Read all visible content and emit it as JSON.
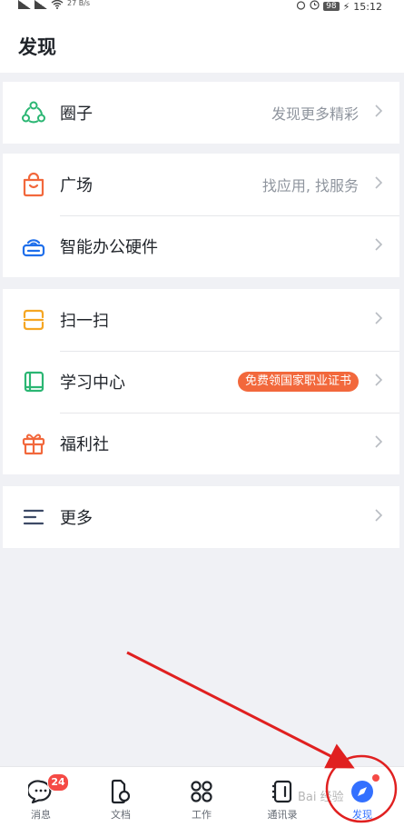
{
  "status_bar": {
    "network_speed": "27\nB/s",
    "battery": "98",
    "time": "15:12"
  },
  "header": {
    "title": "发现"
  },
  "sections": [
    {
      "items": [
        {
          "label": "圈子",
          "icon": "circle-group-icon",
          "right_text": "发现更多精彩"
        }
      ]
    },
    {
      "items": [
        {
          "label": "广场",
          "icon": "shopping-bag-icon",
          "right_text": "找应用, 找服务"
        },
        {
          "label": "智能办公硬件",
          "icon": "router-hardware-icon",
          "right_text": ""
        }
      ]
    },
    {
      "items": [
        {
          "label": "扫一扫",
          "icon": "scan-icon",
          "right_text": ""
        },
        {
          "label": "学习中心",
          "icon": "book-icon",
          "badge": "免费领国家职业证书"
        },
        {
          "label": "福利社",
          "icon": "gift-icon",
          "right_text": ""
        }
      ]
    },
    {
      "items": [
        {
          "label": "更多",
          "icon": "menu-lines-icon",
          "right_text": ""
        }
      ]
    }
  ],
  "tabbar": {
    "items": [
      {
        "label": "消息",
        "icon": "chat-bubble-icon",
        "badge": "24"
      },
      {
        "label": "文档",
        "icon": "document-icon"
      },
      {
        "label": "工作",
        "icon": "apps-grid-icon"
      },
      {
        "label": "通讯录",
        "icon": "contacts-book-icon"
      },
      {
        "label": "发现",
        "icon": "discover-compass-icon",
        "active": true,
        "dot": true
      }
    ]
  },
  "colors": {
    "accent": "#3370ff",
    "badge_red": "#f54a45",
    "promo_orange": "#f2683c",
    "annotation_red": "#e02020"
  },
  "watermark": "Bai 经验"
}
